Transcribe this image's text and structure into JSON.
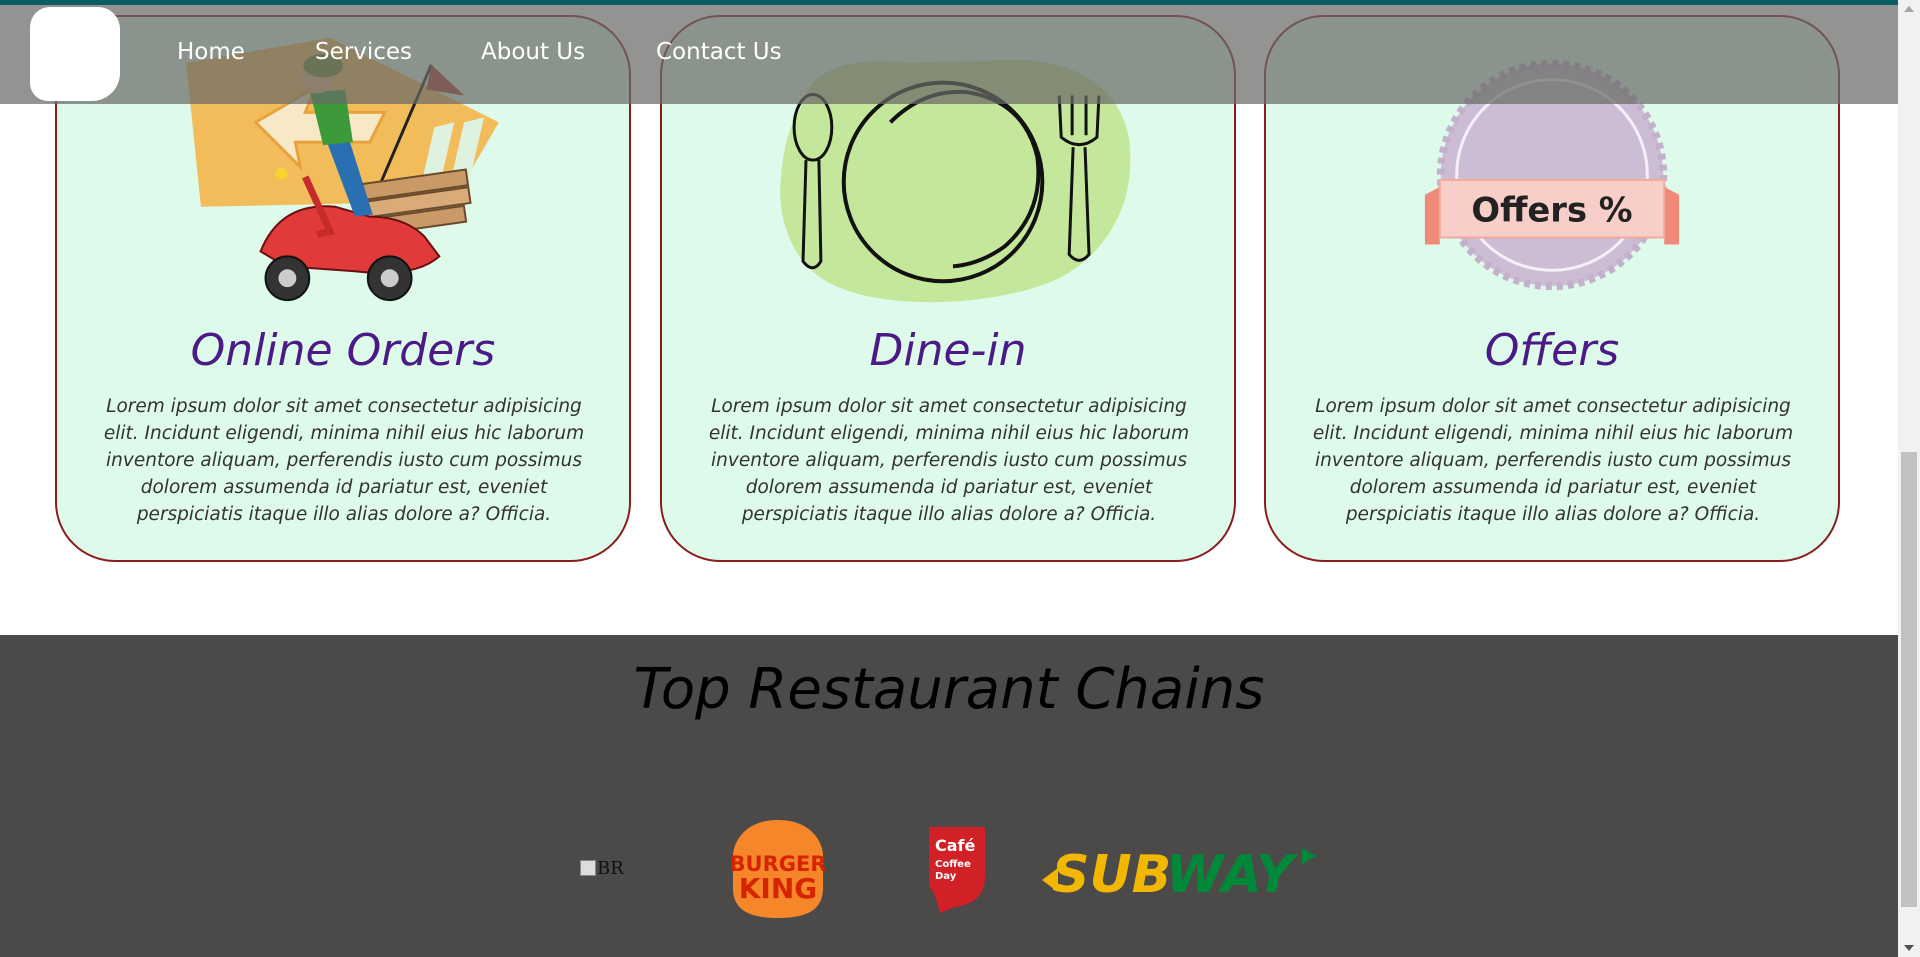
{
  "nav": {
    "items": [
      {
        "label": "Home"
      },
      {
        "label": "Services"
      },
      {
        "label": "About Us"
      },
      {
        "label": "Contact Us"
      }
    ]
  },
  "services": [
    {
      "title": "Online Orders",
      "icon": "delivery-scooter-icon",
      "text": "Lorem ipsum dolor sit amet consectetur adipisicing elit. Incidunt eligendi, minima nihil eius hic laborum inventore aliquam, perferendis iusto cum possimus dolorem assumenda id pariatur est, eveniet perspiciatis itaque illo alias dolore a? Officia."
    },
    {
      "title": "Dine-in",
      "icon": "plate-cutlery-icon",
      "text": "Lorem ipsum dolor sit amet consectetur adipisicing elit. Incidunt eligendi, minima nihil eius hic laborum inventore aliquam, perferendis iusto cum possimus dolorem assumenda id pariatur est, eveniet perspiciatis itaque illo alias dolore a? Officia."
    },
    {
      "title": "Offers",
      "icon": "offer-badge-icon",
      "badge_text": "Offers %",
      "text": "Lorem ipsum dolor sit amet consectetur adipisicing elit. Incidunt eligendi, minima nihil eius hic laborum inventore aliquam, perferendis iusto cum possimus dolorem assumenda id pariatur est, eveniet perspiciatis itaque illo alias dolore a? Officia."
    }
  ],
  "chains": {
    "title": "Top Restaurant Chains",
    "brands": [
      {
        "alt_text": "BR"
      },
      {
        "logo_text": [
          "BURGER",
          "KING"
        ]
      },
      {
        "logo_text": [
          "Café",
          "Coffee",
          "Day"
        ]
      },
      {
        "logo_text": [
          "SUB",
          "WAY"
        ]
      }
    ]
  },
  "colors": {
    "card_bg": "#ddfaeb",
    "card_border": "#8a1c1c",
    "title_purple": "#4b1a86",
    "footer_bg": "#4b4a49",
    "navbar_bg": "rgba(105,107,103,0.72)",
    "top_line": "#0c5c63"
  }
}
